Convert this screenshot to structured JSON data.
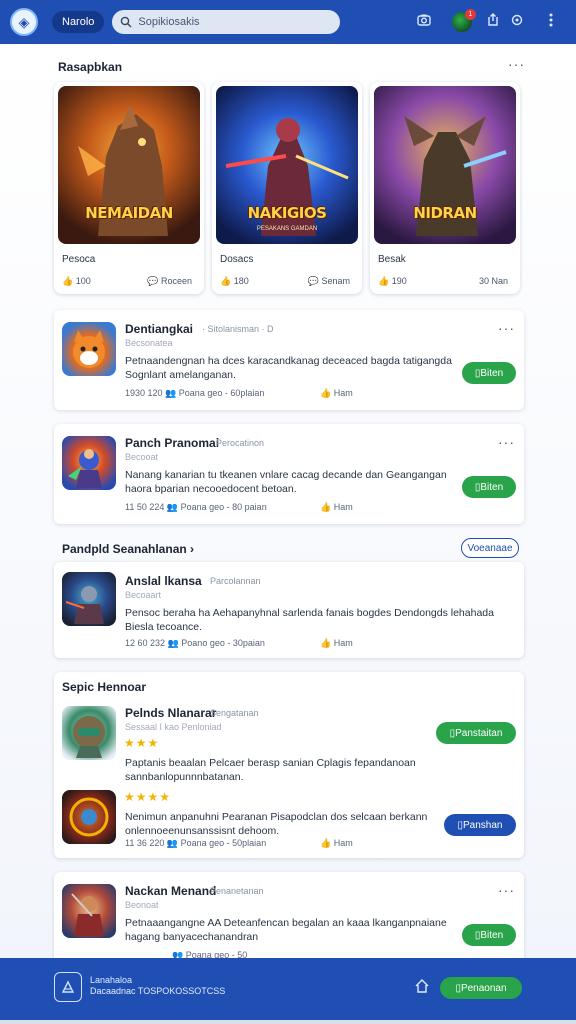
{
  "topbar": {
    "pill_label": "Narolo",
    "search_placeholder": "Sopikiosakis",
    "notification_count": "1",
    "logo_glyph": "◈"
  },
  "featured": {
    "heading": "Rasapbkan",
    "items": [
      {
        "art_title": "NEMAIDAN",
        "art_sub": "",
        "name": "Pesoca",
        "stat_left": "100",
        "stat_right": "Roceen"
      },
      {
        "art_title": "NAKIGIOS",
        "art_sub": "PESAKANS GAMDAN",
        "name": "Dosacs",
        "stat_left": "180",
        "stat_right": "Senam"
      },
      {
        "art_title": "NIDRAN",
        "art_sub": "",
        "name": "Besak",
        "stat_left": "190",
        "stat_right": "30 Nan"
      }
    ]
  },
  "list1": [
    {
      "title": "Dentiangkai",
      "meta": "· Sitolanisman · D",
      "sub": "Becsonatea",
      "desc": "Petnaandengnan ha dces karacandkanag deceaced bagda tatigangda Sognlant amelanganan.",
      "date": "1930 120",
      "people": "Poana geo - 60plaian",
      "fav": "Ham",
      "action": "Biten"
    },
    {
      "title": "Panch Pranomai",
      "meta": "Perocatinon",
      "sub": "Becooat",
      "desc": "Nanang kanarian tu tkeanen vnlare cacag decande dan Geangangan haora bparian necooedocent betoan.",
      "date": "11 50 224",
      "people": "Poana geo - 80 paian",
      "fav": "Ham",
      "action": "Biten"
    }
  ],
  "section2": {
    "heading": "Pandpld Seanahlanan",
    "button": "Voeanaae"
  },
  "card3": {
    "title": "Anslal lkansa",
    "meta": "Parcolannan",
    "sub": "Becoaart",
    "desc": "Pensoc beraha ha Aehapanyhnal sarlenda fanais bogdes Dendongds lehahada Biesla tecoance.",
    "date": "12 60 232",
    "people": "Poano geo - 30paian",
    "fav": "Ham"
  },
  "section3": {
    "heading": "Sepic Hennoar",
    "items": [
      {
        "title": "Pelnds Nlanarar",
        "meta": "Sengatanan",
        "sub": "Sessaal I kao Penloniad",
        "stars": "★★★",
        "desc": "Paptanis beaalan Pelcaer berasp sanian Cplagis fepandanoan sannbanlopunnnbatanan.",
        "action": "Panstaitan"
      },
      {
        "title": "",
        "meta": "",
        "sub": "",
        "stars": "★★★★",
        "desc": "Nenimun anpanuhni Pearanan Pisapodclan dos selcaan berkann onlennoeenunsanssisnt dehoom.",
        "action": "Panshan"
      }
    ],
    "date": "11 36 220",
    "people": "Poana geo - 50plaian",
    "fav": "Ham"
  },
  "card5": {
    "title": "Nackan Menand",
    "meta": "Penanetanan",
    "sub": "Beonoat",
    "desc": "Petnaaangangne AA Deteanfencan begalan an kaaa lkanganpnaiane hagang banyacechanandran",
    "people": "Poana geo - 50",
    "action": "Biten"
  },
  "bottombar": {
    "line1": "Lanahaloa",
    "line2": "Dacaadnac TOSPOKOSSOTCSS",
    "button": "Penaonan"
  },
  "colors": {
    "brand": "#1f4fb3",
    "accent_green": "#2aa44a",
    "star": "#f2b400"
  }
}
